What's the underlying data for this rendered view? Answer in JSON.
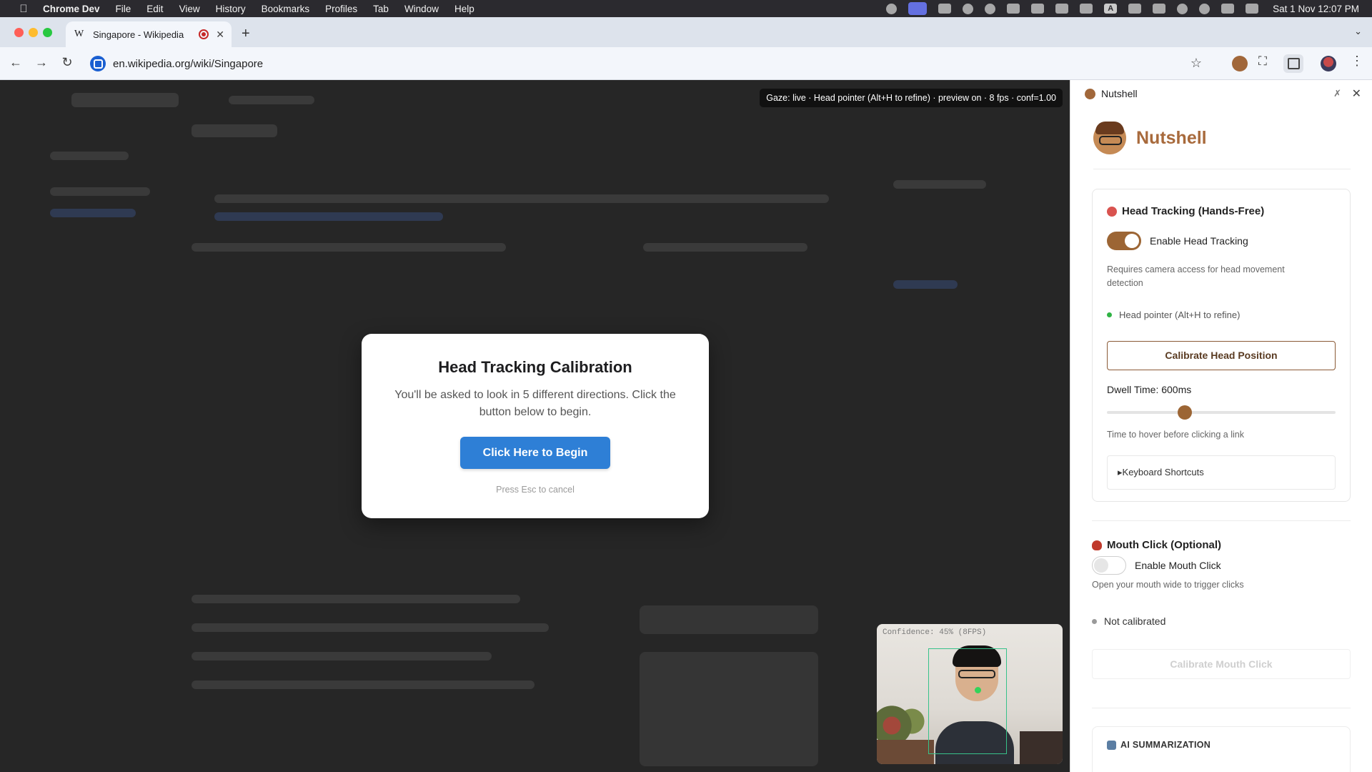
{
  "menubar": {
    "app": "Chrome Dev",
    "items": [
      "File",
      "Edit",
      "View",
      "History",
      "Bookmarks",
      "Profiles",
      "Tab",
      "Window",
      "Help"
    ],
    "input_letter": "A",
    "clock": "Sat 1 Nov  12:07 PM"
  },
  "browser": {
    "tab_title": "Singapore - Wikipedia",
    "tab_favicon": "W",
    "url": "en.wikipedia.org/wiki/Singapore"
  },
  "page": {
    "gaze_status": "Gaze: live · Head pointer (Alt+H to refine) · preview on · 8 fps · conf=1.00"
  },
  "modal": {
    "title": "Head Tracking Calibration",
    "body": "You'll be asked to look in 5 different directions. Click the button below to begin.",
    "button": "Click Here to Begin",
    "hint": "Press Esc to cancel"
  },
  "camera": {
    "overlay_label": "Confidence: 45% (8FPS)"
  },
  "panel": {
    "header_title": "Nutshell",
    "brand": "Nutshell",
    "head_tracking": {
      "title": "Head Tracking (Hands-Free)",
      "toggle_label": "Enable Head Tracking",
      "enabled": true,
      "toggle_hint": "Requires camera access for head movement detection",
      "status": "Head pointer (Alt+H to refine)",
      "status_color": "#2fb344",
      "calibrate_button": "Calibrate Head Position",
      "dwell_label": "Dwell Time: 600ms",
      "dwell_fraction": 0.34,
      "dwell_hint": "Time to hover before clicking a link",
      "shortcuts": "▸Keyboard Shortcuts"
    },
    "mouth_click": {
      "title": "Mouth Click (Optional)",
      "toggle_label": "Enable Mouth Click",
      "enabled": false,
      "hint": "Open your mouth wide to trigger clicks",
      "status": "Not calibrated",
      "status_color": "#9a9a9a",
      "calibrate_button": "Calibrate Mouth Click"
    },
    "ai": {
      "title": "AI SUMMARIZATION"
    }
  },
  "colors": {
    "accent_brown": "#9c6534",
    "button_blue": "#2e7fd6"
  }
}
